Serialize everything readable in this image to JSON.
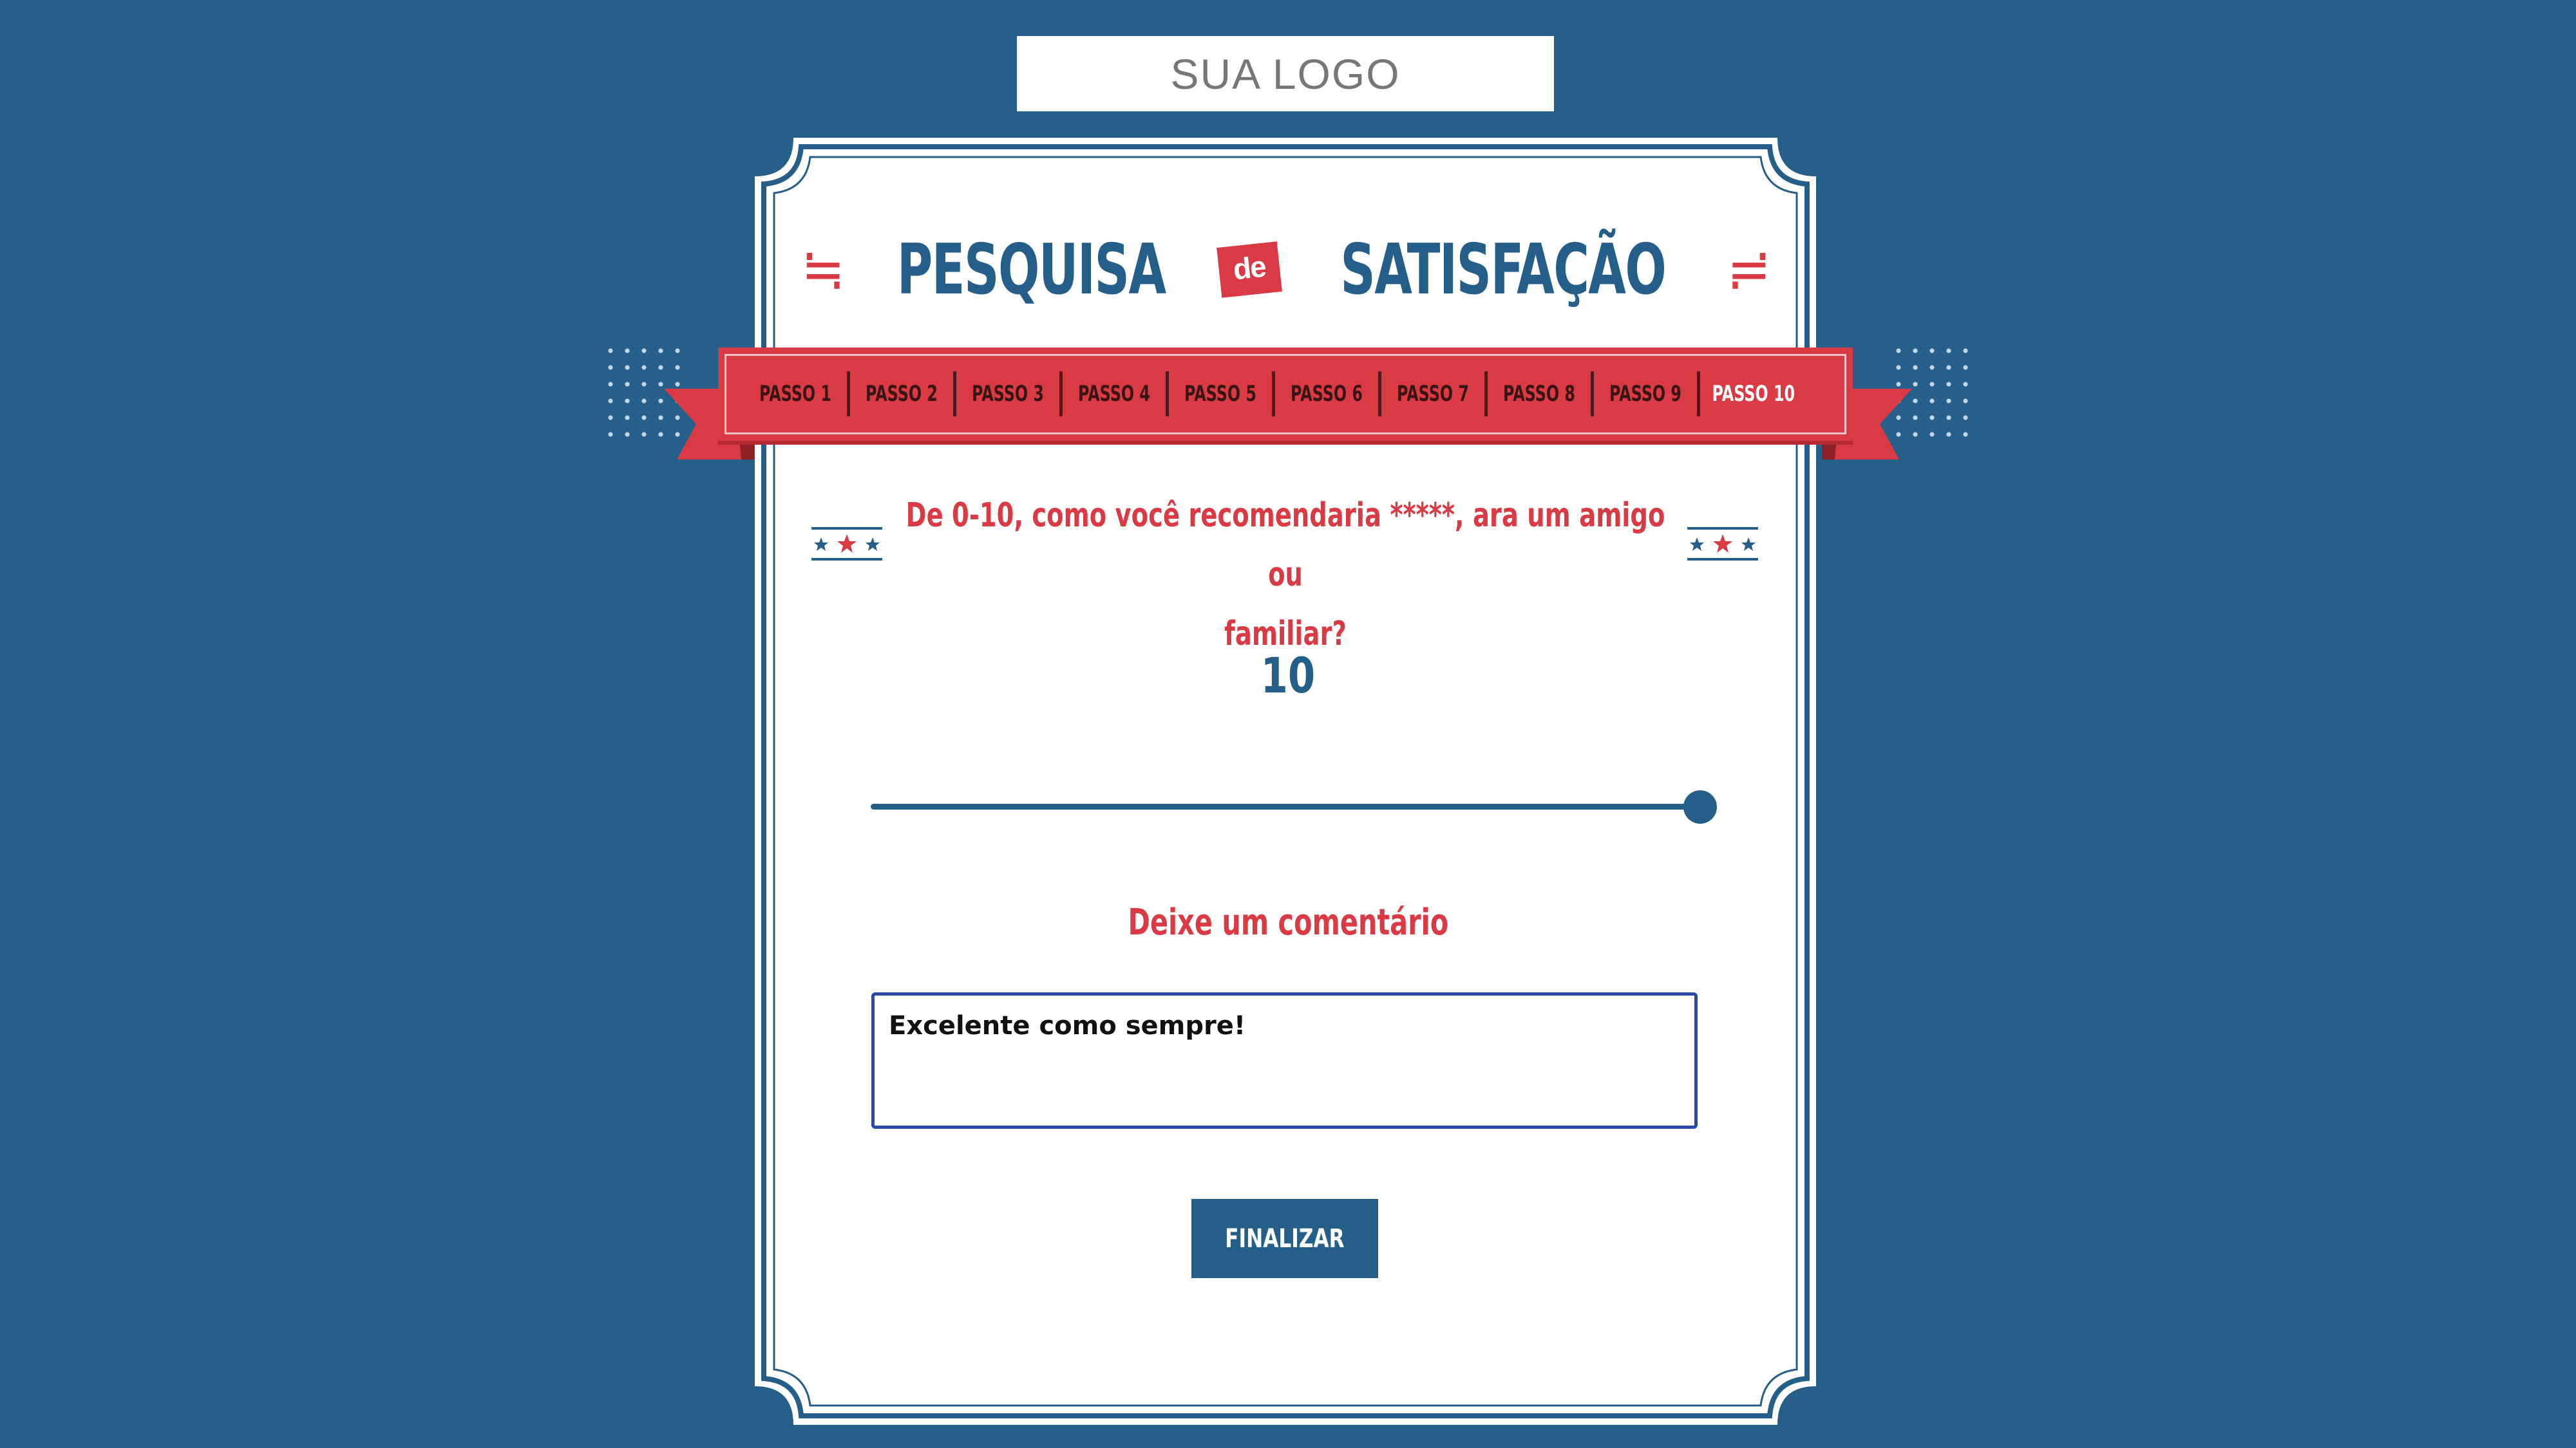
{
  "logo": {
    "text": "SUA LOGO"
  },
  "header": {
    "title_left": "PESQUISA",
    "title_connector": "de",
    "title_right": "SATISFAÇÃO"
  },
  "steps": {
    "items": [
      {
        "label": "PASSO 1"
      },
      {
        "label": "PASSO 2"
      },
      {
        "label": "PASSO 3"
      },
      {
        "label": "PASSO 4"
      },
      {
        "label": "PASSO 5"
      },
      {
        "label": "PASSO 6"
      },
      {
        "label": "PASSO 7"
      },
      {
        "label": "PASSO 8"
      },
      {
        "label": "PASSO 9"
      },
      {
        "label": "PASSO 10"
      }
    ],
    "active_index": 9
  },
  "question": {
    "line1": "De 0-10, como você recomendaria *****, ara um amigo ou",
    "line2": "familiar?"
  },
  "rating": {
    "value_text": "10",
    "value": 10,
    "min": 0,
    "max": 10
  },
  "comment": {
    "label": "Deixe um comentário",
    "value": "Excelente como sempre!"
  },
  "actions": {
    "finish_label": "FINALIZAR"
  },
  "colors": {
    "background": "#245e89",
    "primary_blue": "#245e89",
    "accent_red": "#d93a43",
    "card": "#ffffff",
    "input_border": "#2a4aa8"
  },
  "icons": {
    "decor_stars": "stars-icon",
    "decor_dots": "dots-pattern",
    "title_flourish": "flourish-icon"
  }
}
